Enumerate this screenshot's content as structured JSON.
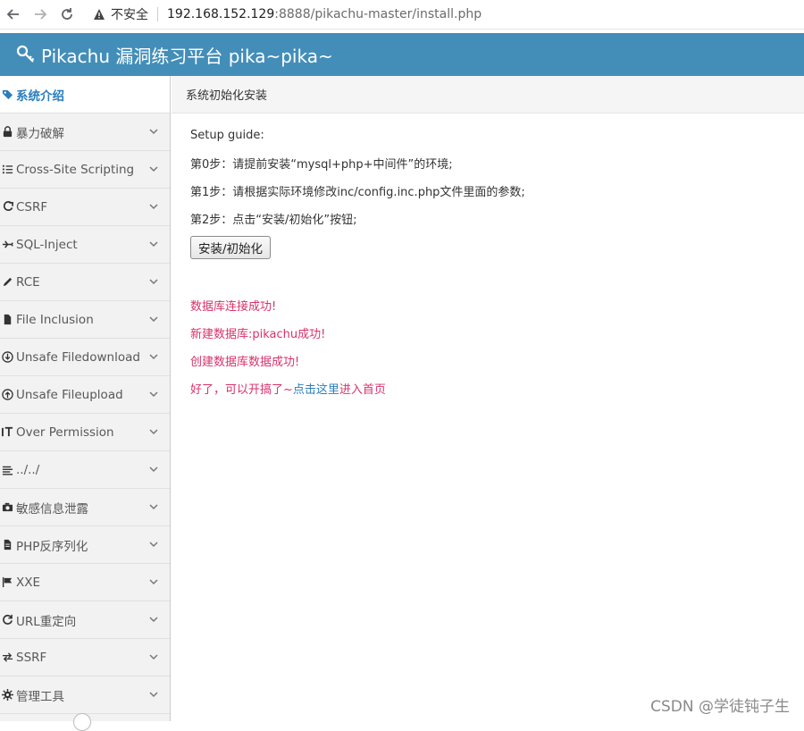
{
  "browser": {
    "security_label": "不安全",
    "url_host": "192.168.152.129",
    "url_rest": ":8888/pikachu-master/install.php"
  },
  "header": {
    "title": "Pikachu 漏洞练习平台 pika~pika~"
  },
  "sidebar": {
    "items": [
      {
        "label": "系统介绍",
        "icon": "tags-icon"
      },
      {
        "label": "暴力破解",
        "icon": "lock-icon"
      },
      {
        "label": "Cross-Site Scripting",
        "icon": "list-icon"
      },
      {
        "label": "CSRF",
        "icon": "share-icon"
      },
      {
        "label": "SQL-Inject",
        "icon": "plane-icon"
      },
      {
        "label": "RCE",
        "icon": "pencil-icon"
      },
      {
        "label": "File Inclusion",
        "icon": "file-icon"
      },
      {
        "label": "Unsafe Filedownload",
        "icon": "download-icon"
      },
      {
        "label": "Unsafe Fileupload",
        "icon": "upload-icon"
      },
      {
        "label": "Over Permission",
        "icon": "text-height-icon"
      },
      {
        "label": "../../",
        "icon": "align-icon"
      },
      {
        "label": "敏感信息泄露",
        "icon": "camera-icon"
      },
      {
        "label": "PHP反序列化",
        "icon": "file-text-icon"
      },
      {
        "label": "XXE",
        "icon": "flag-icon"
      },
      {
        "label": "URL重定向",
        "icon": "refresh-icon"
      },
      {
        "label": "SSRF",
        "icon": "exchange-icon"
      },
      {
        "label": "管理工具",
        "icon": "cog-icon"
      }
    ]
  },
  "breadcrumb": {
    "current": "系统初始化安装"
  },
  "main": {
    "setup_title": "Setup guide:",
    "step0": "第0步：请提前安装“mysql+php+中间件”的环境;",
    "step1": "第1步：请根据实际环境修改inc/config.inc.php文件里面的参数;",
    "step2": "第2步：点击“安装/初始化”按钮;",
    "install_button": "安装/初始化",
    "msg_db_connect": "数据库连接成功!",
    "msg_db_create": "新建数据库:pikachu成功!",
    "msg_data_create": "创建数据库数据成功!",
    "msg_done_prefix": "好了，可以开搞了~",
    "msg_done_link": "点击这里",
    "msg_done_suffix": "进入首页"
  },
  "watermark": "CSDN @学徒钝子生",
  "colors": {
    "header": "#438eb9",
    "accent": "#2b7dbc",
    "message": "#d6336c"
  }
}
